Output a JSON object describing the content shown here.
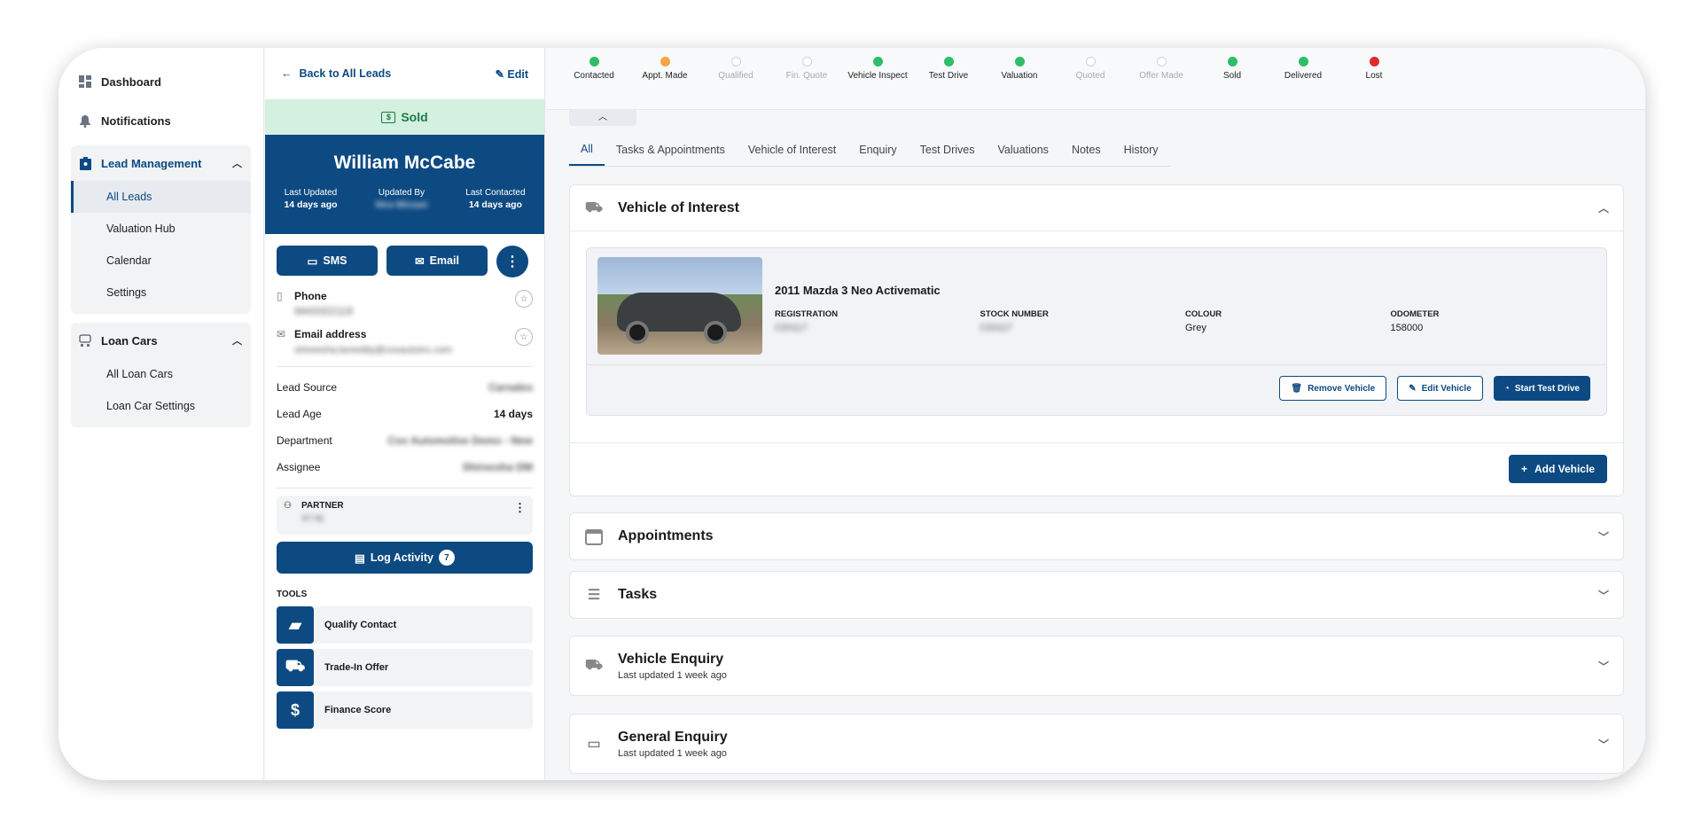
{
  "sidebar": {
    "dashboard": "Dashboard",
    "notifications": "Notifications",
    "lead_management": "Lead Management",
    "lead_items": [
      "All Leads",
      "Valuation Hub",
      "Calendar",
      "Settings"
    ],
    "loan_cars": "Loan Cars",
    "loan_items": [
      "All Loan Cars",
      "Loan Car Settings"
    ]
  },
  "lead": {
    "back": "Back to All Leads",
    "edit": "Edit",
    "status": "Sold",
    "name": "William McCabe",
    "last_updated_label": "Last Updated",
    "last_updated": "14 days ago",
    "updated_by_label": "Updated By",
    "updated_by": "Nira Mirzaei",
    "last_contacted_label": "Last Contacted",
    "last_contacted": "14 days ago",
    "sms": "SMS",
    "email": "Email",
    "phone_label": "Phone",
    "phone": "9443322119",
    "email_label": "Email address",
    "email_value": "shireesha.boreddy@coxautoinc.com",
    "fields": [
      {
        "label": "Lead Source",
        "value": "Carsales"
      },
      {
        "label": "Lead Age",
        "value": "14 days"
      },
      {
        "label": "Department",
        "value": "Cox Automotive Demo - New"
      },
      {
        "label": "Assignee",
        "value": "Shireesha DM"
      }
    ],
    "partner_label": "PARTNER",
    "partner": "sri raj",
    "log_activity": "Log Activity",
    "log_count": "7",
    "tools_label": "TOOLS",
    "tools": [
      "Qualify Contact",
      "Trade-In Offer",
      "Finance Score"
    ]
  },
  "stages": [
    {
      "label": "Contacted",
      "state": "green"
    },
    {
      "label": "Appt. Made",
      "state": "orange"
    },
    {
      "label": "Qualified",
      "state": "grey"
    },
    {
      "label": "Fin. Quote",
      "state": "grey"
    },
    {
      "label": "Vehicle Inspect",
      "state": "green"
    },
    {
      "label": "Test Drive",
      "state": "green"
    },
    {
      "label": "Valuation",
      "state": "green"
    },
    {
      "label": "Quoted",
      "state": "grey"
    },
    {
      "label": "Offer Made",
      "state": "grey"
    },
    {
      "label": "Sold",
      "state": "green"
    },
    {
      "label": "Delivered",
      "state": "green"
    },
    {
      "label": "Lost",
      "state": "red"
    }
  ],
  "tabs": [
    "All",
    "Tasks & Appointments",
    "Vehicle of Interest",
    "Enquiry",
    "Test Drives",
    "Valuations",
    "Notes",
    "History"
  ],
  "voi": {
    "title": "Vehicle of Interest",
    "vehicle": "2011 Mazda 3 Neo Activematic",
    "specs": [
      {
        "label": "REGISTRATION",
        "value": "CDI117"
      },
      {
        "label": "STOCK NUMBER",
        "value": "CDI117"
      },
      {
        "label": "COLOUR",
        "value": "Grey"
      },
      {
        "label": "ODOMETER",
        "value": "158000"
      }
    ],
    "remove": "Remove Vehicle",
    "edit": "Edit Vehicle",
    "start": "Start Test Drive",
    "add": "Add Vehicle"
  },
  "panels": {
    "appointments": "Appointments",
    "tasks": "Tasks",
    "vehicle_enquiry": "Vehicle Enquiry",
    "vehicle_enquiry_sub": "Last updated 1 week ago",
    "general_enquiry": "General Enquiry",
    "general_enquiry_sub": "Last updated 1 week ago"
  },
  "colors": {
    "primary": "#0d4a82",
    "sold_bg": "#d4f0e0",
    "green": "#2ebd6b",
    "orange": "#f5a446",
    "red": "#e02b2b"
  }
}
